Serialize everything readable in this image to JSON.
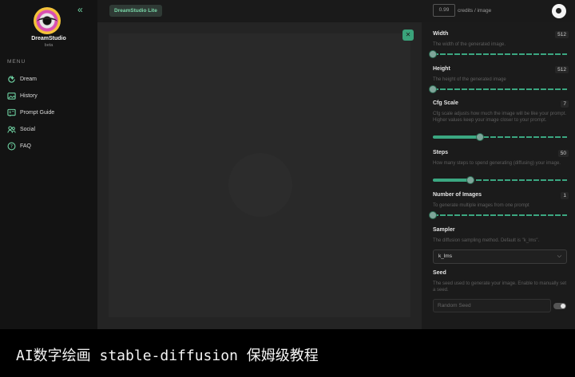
{
  "app": {
    "brand": "DreamStudio",
    "brand_sub": "beta",
    "menu_title": "MENU",
    "nav": [
      {
        "label": "Dream",
        "icon": "dream-icon"
      },
      {
        "label": "History",
        "icon": "history-icon"
      },
      {
        "label": "Prompt Guide",
        "icon": "prompt-guide-icon"
      },
      {
        "label": "Social",
        "icon": "social-icon"
      },
      {
        "label": "FAQ",
        "icon": "faq-icon"
      }
    ]
  },
  "topbar": {
    "tab_label": "DreamStudio Lite",
    "credits_value": "0.99",
    "credits_label": "credits / image"
  },
  "panel": {
    "width": {
      "label": "Width",
      "value": "512",
      "desc": "The width of the generated image.",
      "level": 0.0
    },
    "height": {
      "label": "Height",
      "value": "512",
      "desc": "The height of the generated image",
      "level": 0.0
    },
    "cfg": {
      "label": "Cfg Scale",
      "value": "7",
      "desc": "Cfg scale adjusts how much the image will be like your prompt. Higher values keep your image closer to your prompt.",
      "level": 0.35
    },
    "steps": {
      "label": "Steps",
      "value": "50",
      "desc": "How many steps to spend generating (diffusing) your image.",
      "level": 0.28
    },
    "num_images": {
      "label": "Number of Images",
      "value": "1",
      "desc": "To generate multiple images from one prompt",
      "level": 0.0
    },
    "sampler": {
      "label": "Sampler",
      "desc": "The diffusion sampling method. Default is \"k_lms\".",
      "value": "k_lms"
    },
    "seed": {
      "label": "Seed",
      "desc": "The seed used to generate your image. Enable to manually set a seed.",
      "placeholder": "Random Seed"
    }
  },
  "caption": "AI数字绘画 stable-diffusion 保姆级教程",
  "colors": {
    "accent": "#3ba781",
    "accent_text": "#79d8a8"
  }
}
